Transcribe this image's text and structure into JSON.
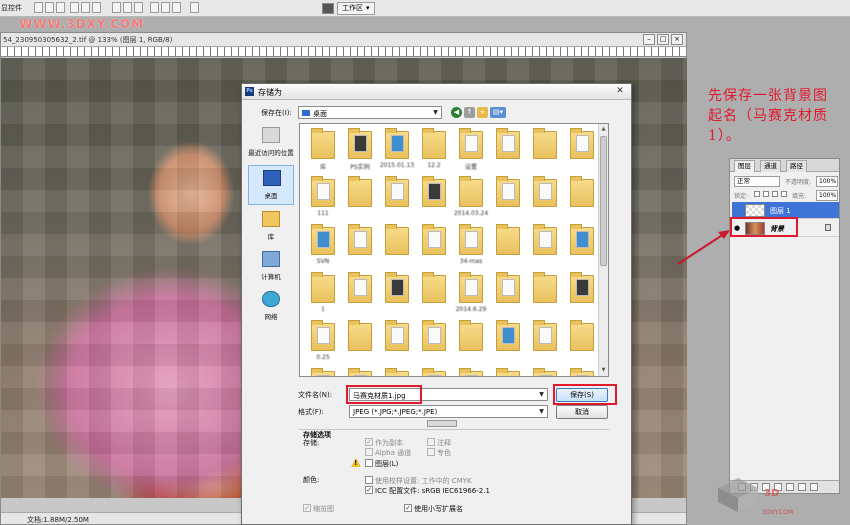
{
  "toolbar": {
    "left_text": "显控件",
    "workspace_label": "工作区",
    "workspace_arrow": "▾"
  },
  "watermark": "WWW.3DXY.COM",
  "document": {
    "title": "54_230950305632_2.tif @ 133% (图层 1, RGB/8)",
    "status": "文档:1.88M/2.50M"
  },
  "dialog": {
    "title": "存储为",
    "close": "✕",
    "save_in_label": "保存在(I):",
    "save_in_value": "桌面",
    "places": [
      {
        "label": "最近访问的位置",
        "icon": "recent-icon"
      },
      {
        "label": "桌面",
        "icon": "desktop-icon"
      },
      {
        "label": "库",
        "icon": "library-icon"
      },
      {
        "label": "计算机",
        "icon": "computer-icon"
      },
      {
        "label": "网络",
        "icon": "network-icon"
      }
    ],
    "files": [
      "库",
      "PS实例",
      "2015.01.13",
      "#########",
      "###",
      "12.2",
      "##########",
      "",
      "####",
      "",
      "",
      "",
      "",
      "",
      "",
      "",
      "",
      "",
      "",
      "",
      "",
      "",
      "",
      "",
      "",
      "",
      "",
      "",
      "",
      "",
      "",
      "",
      "",
      "",
      "",
      "",
      "",
      "",
      "",
      "",
      "",
      "",
      "",
      ""
    ],
    "visible_file_labels": [
      "库",
      "PS实例",
      "2015.01.13",
      "12.2",
      "设置",
      "111",
      "2014.03.24",
      "SVN",
      "34-mas",
      "1",
      "2014.6.29",
      "0.25"
    ],
    "filename_label": "文件名(N):",
    "filename_value": "马赛克材质1.jpg",
    "format_label": "格式(F):",
    "format_value": "JPEG (*.JPG;*.JPEG;*.JPE)",
    "save_button": "保存(S)",
    "cancel_button": "取消",
    "options_header": "存储选项",
    "storage_label": "存储:",
    "opt_copy": "作为副本",
    "opt_notes": "注释",
    "opt_alpha": "Alpha 通道",
    "opt_spot": "专色",
    "opt_layers": "图层(L)",
    "color_label": "颜色:",
    "opt_proof": "使用校样设置: 工作中的 CMYK",
    "opt_icc": "ICC 配置文件: sRGB IEC61966-2.1",
    "opt_thumb": "缩览图",
    "opt_lower": "使用小写扩展名"
  },
  "annotation": "先保存一张背景图起名（马赛克材质1）。",
  "layers_panel": {
    "tabs": [
      "图层",
      "通道",
      "路径"
    ],
    "mode": "正常",
    "opacity_label": "不透明度:",
    "opacity": "100%",
    "lock_label": "锁定:",
    "fill_label": "填充:",
    "fill": "100%",
    "layers": [
      {
        "name": "图层 1",
        "selected": true
      },
      {
        "name": "背景",
        "selected": false
      }
    ]
  },
  "logo_text": "3DXY.COM",
  "colors": {
    "highlight": "#e0192e",
    "annotation": "#e0192e",
    "selection": "#3d74d6"
  }
}
